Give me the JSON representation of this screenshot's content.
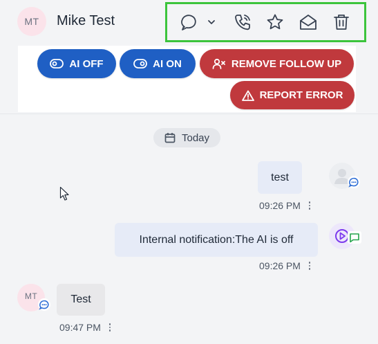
{
  "header": {
    "avatar_initials": "MT",
    "contact_name": "Mike Test"
  },
  "toolbar": {
    "icons": [
      "chat-bubble-icon",
      "chevron-down-icon",
      "phone-icon",
      "star-icon",
      "envelope-icon",
      "trash-icon"
    ],
    "highlight_color": "#3cc43c"
  },
  "actions": {
    "ai_off_label": "AI OFF",
    "ai_on_label": "AI ON",
    "remove_follow_up_label": "REMOVE FOLLOW UP",
    "report_error_label": "REPORT ERROR"
  },
  "colors": {
    "blue_button": "#1f5fc4",
    "red_button": "#c0393d"
  },
  "conversation": {
    "date_label": "Today",
    "messages": [
      {
        "direction": "outgoing",
        "text": "test",
        "time": "09:26 PM"
      },
      {
        "direction": "outgoing",
        "text": "Internal notification:The AI is off",
        "time": "09:26 PM"
      },
      {
        "direction": "incoming",
        "avatar_initials": "MT",
        "text": "Test",
        "time": "09:47 PM"
      }
    ]
  }
}
